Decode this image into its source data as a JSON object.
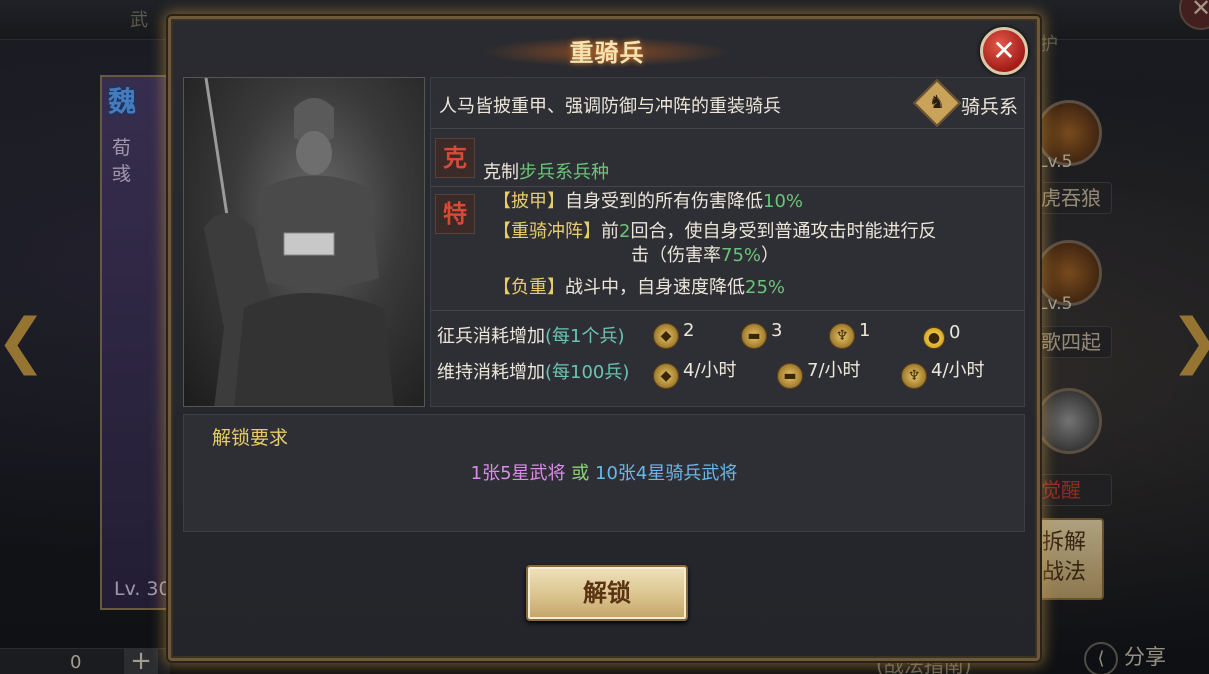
{
  "background": {
    "top_left_text": "武",
    "top_right_text": "护",
    "faction": "魏",
    "general_name": "荀彧",
    "general_level": "Lv. 30",
    "skills": [
      {
        "level": "Lv.5",
        "name": "虎吞狼"
      },
      {
        "level": "Lv.5",
        "name": "歌四起"
      },
      {
        "level": "",
        "name": "觉醒"
      }
    ],
    "disassemble_label": "拆解战法",
    "bottom_counter": "0",
    "plus": "+",
    "tactics_guide": "(战法指南)",
    "share_label": "分享",
    "left_arrow": "❮",
    "right_arrow": "❯"
  },
  "modal": {
    "title": "重骑兵",
    "close_symbol": "✕",
    "description": "人马皆披重甲、强调防御与冲阵的重装骑兵",
    "type_label": "骑兵系",
    "counter": {
      "badge": "克",
      "prefix": "克制",
      "target": "步兵系兵种"
    },
    "traits_badge": "特",
    "traits": [
      {
        "name": "【披甲】",
        "text_a": "自身受到的所有伤害降低",
        "value": "10%",
        "text_b": ""
      },
      {
        "name": "【重骑冲阵】",
        "text_a": "前",
        "value": "2",
        "text_b": "回合，使自身受到普通攻击时能进行反"
      },
      {
        "name": "【负重】",
        "text_a": "战斗中，自身速度降低",
        "value": "25%",
        "text_b": ""
      }
    ],
    "trait2_line2_a": "击（伤害率",
    "trait2_line2_value": "75%",
    "trait2_line2_b": "）",
    "recruit": {
      "label": "征兵消耗增加",
      "unit": "(每1个兵)",
      "costs": [
        "2",
        "3",
        "1",
        "0"
      ]
    },
    "upkeep": {
      "label": "维持消耗增加",
      "unit": "(每100兵)",
      "costs": [
        "4/小时",
        "7/小时",
        "4/小时"
      ]
    },
    "unlock": {
      "title": "解锁要求",
      "option_a": "1张5星武将",
      "or": "或",
      "option_b": "10张4星骑兵武将"
    },
    "unlock_button": "解锁"
  },
  "colors": {
    "accent_gold": "#c99d45",
    "highlight_green": "#6cc47a",
    "close_red": "#a21c18"
  }
}
